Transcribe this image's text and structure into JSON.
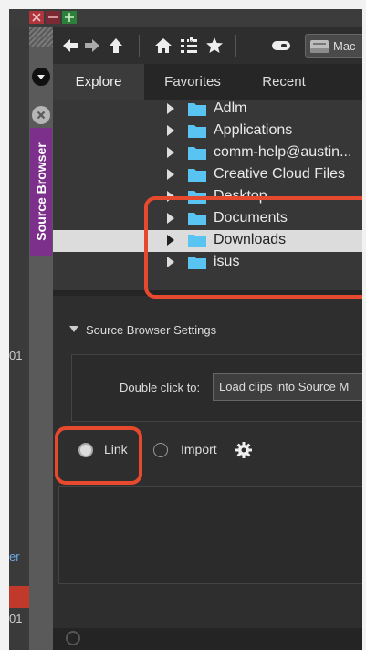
{
  "toolbar": {
    "location_button": "Mac",
    "icons": [
      "back-arrow-icon",
      "forward-arrow-icon",
      "up-arrow-icon",
      "home-icon",
      "bookmark-list-icon",
      "star-icon",
      "drive-icon"
    ]
  },
  "tabs": [
    {
      "label": "Explore",
      "active": true
    },
    {
      "label": "Favorites",
      "active": false
    },
    {
      "label": "Recent",
      "active": false
    }
  ],
  "side_tab": {
    "label": "Source Browser"
  },
  "tree": {
    "items": [
      {
        "label": "Adlm",
        "selected": false
      },
      {
        "label": "Applications",
        "selected": false
      },
      {
        "label": "comm-help@austin...",
        "selected": false
      },
      {
        "label": "Creative Cloud Files",
        "selected": false
      },
      {
        "label": "Desktop",
        "selected": false
      },
      {
        "label": "Documents",
        "selected": false
      },
      {
        "label": "Downloads",
        "selected": true
      },
      {
        "label": "isus",
        "selected": false
      }
    ]
  },
  "settings": {
    "heading": "Source Browser Settings",
    "double_click_label": "Double click to:",
    "double_click_value": "Load clips into Source M",
    "mode_options": [
      {
        "label": "Link",
        "checked": true
      },
      {
        "label": "Import",
        "checked": false
      }
    ]
  },
  "left_strip": {
    "texts": [
      "01",
      "er",
      "01"
    ]
  },
  "colors": {
    "highlight": "#e64a2e",
    "side_tab": "#7d2f8c",
    "folder": "#59c3f2"
  }
}
